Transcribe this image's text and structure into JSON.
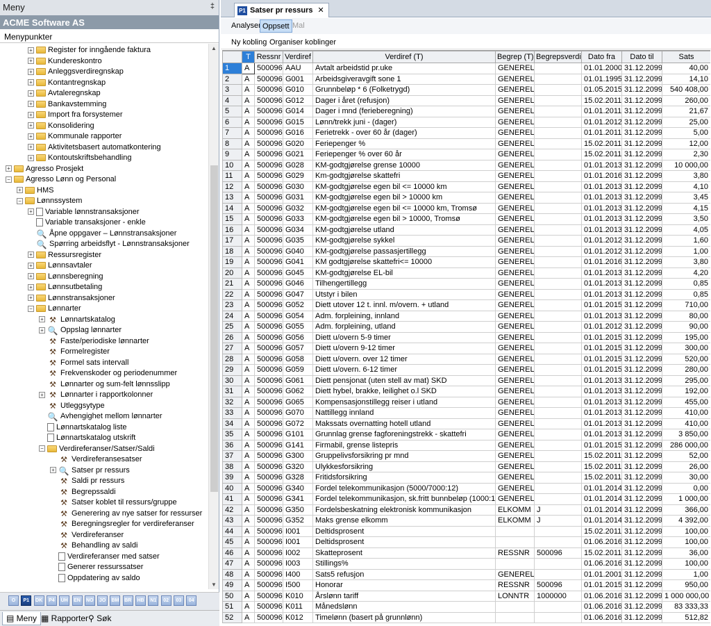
{
  "menu": {
    "title": "Meny",
    "pin": "‡",
    "company": "ACME Software AS",
    "section": "Menypunkter"
  },
  "tree": [
    {
      "l": "Register for inngående faktura",
      "lv": 2,
      "i": "folder",
      "e": "+"
    },
    {
      "l": "Kundereskontro",
      "lv": 2,
      "i": "folder",
      "e": "+"
    },
    {
      "l": "Anleggsverdiregnskap",
      "lv": 2,
      "i": "folder",
      "e": "+"
    },
    {
      "l": "Kontantregnskap",
      "lv": 2,
      "i": "folder",
      "e": "+"
    },
    {
      "l": "Avtaleregnskap",
      "lv": 2,
      "i": "folder",
      "e": "+"
    },
    {
      "l": "Bankavstemming",
      "lv": 2,
      "i": "folder",
      "e": "+"
    },
    {
      "l": "Import fra forsystemer",
      "lv": 2,
      "i": "folder",
      "e": "+"
    },
    {
      "l": "Konsolidering",
      "lv": 2,
      "i": "folder",
      "e": "+"
    },
    {
      "l": "Kommunale rapporter",
      "lv": 2,
      "i": "folder",
      "e": "+"
    },
    {
      "l": "Aktivitetsbasert automatkontering",
      "lv": 2,
      "i": "folder",
      "e": "+"
    },
    {
      "l": "Kontoutskriftsbehandling",
      "lv": 2,
      "i": "folder",
      "e": "+"
    },
    {
      "l": "Agresso Prosjekt",
      "lv": 0,
      "i": "folder",
      "e": "+"
    },
    {
      "l": "Agresso Lønn og Personal",
      "lv": 0,
      "i": "folder",
      "e": "−"
    },
    {
      "l": "HMS",
      "lv": 1,
      "i": "folder",
      "e": "+"
    },
    {
      "l": "Lønnssystem",
      "lv": 1,
      "i": "folder",
      "e": "−"
    },
    {
      "l": "Variable lønnstransaksjoner",
      "lv": 2,
      "i": "doc",
      "e": "+"
    },
    {
      "l": "Variable transaksjoner - enkle",
      "lv": 2,
      "i": "doc",
      "e": ""
    },
    {
      "l": "Åpne oppgaver – Lønnstransaksjoner",
      "lv": 2,
      "i": "mag",
      "e": ""
    },
    {
      "l": "Spørring arbeidsflyt - Lønnstransaksjoner",
      "lv": 2,
      "i": "mag",
      "e": ""
    },
    {
      "l": "Ressursregister",
      "lv": 2,
      "i": "folder",
      "e": "+"
    },
    {
      "l": "Lønnsavtaler",
      "lv": 2,
      "i": "folder",
      "e": "+"
    },
    {
      "l": "Lønnsberegning",
      "lv": 2,
      "i": "folder",
      "e": "+"
    },
    {
      "l": "Lønnsutbetaling",
      "lv": 2,
      "i": "folder",
      "e": "+"
    },
    {
      "l": "Lønnstransaksjoner",
      "lv": 2,
      "i": "folder",
      "e": "+"
    },
    {
      "l": "Lønnarter",
      "lv": 2,
      "i": "folder",
      "e": "−"
    },
    {
      "l": "Lønnartskatalog",
      "lv": 3,
      "i": "tool",
      "e": "+"
    },
    {
      "l": "Oppslag lønnarter",
      "lv": 3,
      "i": "mag",
      "e": "+"
    },
    {
      "l": "Faste/periodiske lønnarter",
      "lv": 3,
      "i": "tool",
      "e": ""
    },
    {
      "l": "Formelregister",
      "lv": 3,
      "i": "tool",
      "e": ""
    },
    {
      "l": "Formel sats intervall",
      "lv": 3,
      "i": "tool",
      "e": ""
    },
    {
      "l": "Frekvenskoder og periodenummer",
      "lv": 3,
      "i": "tool",
      "e": ""
    },
    {
      "l": "Lønnarter og sum-felt lønnsslipp",
      "lv": 3,
      "i": "tool",
      "e": ""
    },
    {
      "l": "Lønnarter i rapportkolonner",
      "lv": 3,
      "i": "tool",
      "e": "+"
    },
    {
      "l": "Utleggsytype",
      "lv": 3,
      "i": "tool",
      "e": ""
    },
    {
      "l": "Avhengighet mellom lønnarter",
      "lv": 3,
      "i": "mag",
      "e": ""
    },
    {
      "l": "Lønnartskatalog liste",
      "lv": 3,
      "i": "doc",
      "e": ""
    },
    {
      "l": "Lønnartskatalog utskrift",
      "lv": 3,
      "i": "doc",
      "e": ""
    },
    {
      "l": "Verdireferanser/Satser/Saldi",
      "lv": 3,
      "i": "folder",
      "e": "−"
    },
    {
      "l": "Verdireferansesatser",
      "lv": 4,
      "i": "tool",
      "e": ""
    },
    {
      "l": "Satser pr ressurs",
      "lv": 4,
      "i": "mag",
      "e": "+"
    },
    {
      "l": "Saldi pr ressurs",
      "lv": 4,
      "i": "tool",
      "e": ""
    },
    {
      "l": "Begrepssaldi",
      "lv": 4,
      "i": "tool",
      "e": ""
    },
    {
      "l": "Satser koblet til ressurs/gruppe",
      "lv": 4,
      "i": "tool",
      "e": ""
    },
    {
      "l": "Generering av nye satser for ressurser",
      "lv": 4,
      "i": "tool",
      "e": ""
    },
    {
      "l": "Beregningsregler for verdireferanser",
      "lv": 4,
      "i": "tool",
      "e": ""
    },
    {
      "l": "Verdireferanser",
      "lv": 4,
      "i": "tool",
      "e": ""
    },
    {
      "l": "Behandling av saldi",
      "lv": 4,
      "i": "tool",
      "e": ""
    },
    {
      "l": "Verdireferanser med satser",
      "lv": 4,
      "i": "doc",
      "e": ""
    },
    {
      "l": "Generer ressurssatser",
      "lv": 4,
      "i": "doc",
      "e": ""
    },
    {
      "l": "Oppdatering av saldo",
      "lv": 4,
      "i": "doc",
      "e": ""
    }
  ],
  "iconbar": [
    "O",
    "P1",
    "DK",
    "P4",
    "UH",
    "EN",
    "NO",
    "JO",
    "BM",
    "BR",
    "HB",
    "N1",
    "02",
    "03",
    "04"
  ],
  "bottom_tabs": {
    "meny": "Meny",
    "rapporter": "Rapporter",
    "sok": "Søk"
  },
  "doc_tab": {
    "icon": "P1",
    "title": "Satser pr ressurs",
    "close": "✕"
  },
  "toolbar": {
    "analyser": "Analyser",
    "oppsett": "Oppsett",
    "mal": "Mal",
    "ny_kobling": "Ny kobling",
    "organiser": "Organiser koblinger"
  },
  "columns": [
    "",
    "T",
    "Ressnr",
    "Verdiref",
    "Verdiref (T)",
    "Begrep (T)",
    "Begrepsverdi",
    "Dato fra",
    "Dato til",
    "Sats"
  ],
  "rows": [
    [
      "1",
      "A",
      "500096",
      "AAU",
      "Avtalt arbeidstid pr.uke",
      "GENERELL",
      "",
      "01.01.2000",
      "31.12.2099",
      "40,00"
    ],
    [
      "2",
      "A",
      "500096",
      "G001",
      "Arbeidsgiveravgift sone 1",
      "GENERELL",
      "",
      "01.01.1995",
      "31.12.2099",
      "14,10"
    ],
    [
      "3",
      "A",
      "500096",
      "G010",
      "Grunnbeløp * 6 (Folketrygd)",
      "GENERELL",
      "",
      "01.05.2015",
      "31.12.2099",
      "540 408,00"
    ],
    [
      "4",
      "A",
      "500096",
      "G012",
      "Dager i året (refusjon)",
      "GENERELL",
      "",
      "15.02.2011",
      "31.12.2099",
      "260,00"
    ],
    [
      "5",
      "A",
      "500096",
      "G014",
      "Dager i mnd (ferieberegning)",
      "GENERELL",
      "",
      "01.01.2011",
      "31.12.2099",
      "21,67"
    ],
    [
      "6",
      "A",
      "500096",
      "G015",
      "Lønn/trekk juni - (dager)",
      "GENERELL",
      "",
      "01.01.2012",
      "31.12.2099",
      "25,00"
    ],
    [
      "7",
      "A",
      "500096",
      "G016",
      "Ferietrekk - over 60 år (dager)",
      "GENERELL",
      "",
      "01.01.2011",
      "31.12.2099",
      "5,00"
    ],
    [
      "8",
      "A",
      "500096",
      "G020",
      "Feriepenger %",
      "GENERELL",
      "",
      "15.02.2011",
      "31.12.2099",
      "12,00"
    ],
    [
      "9",
      "A",
      "500096",
      "G021",
      "Feriepenger % over 60 år",
      "GENERELL",
      "",
      "15.02.2011",
      "31.12.2099",
      "2,30"
    ],
    [
      "10",
      "A",
      "500096",
      "G028",
      "KM-godtgjørelse grense 10000",
      "GENERELL",
      "",
      "01.01.2013",
      "31.12.2099",
      "10 000,00"
    ],
    [
      "11",
      "A",
      "500096",
      "G029",
      "Km-godtgjørelse skattefri",
      "GENERELL",
      "",
      "01.01.2016",
      "31.12.2099",
      "3,80"
    ],
    [
      "12",
      "A",
      "500096",
      "G030",
      "KM-godtgjørelse egen bil <= 10000 km",
      "GENERELL",
      "",
      "01.01.2013",
      "31.12.2099",
      "4,10"
    ],
    [
      "13",
      "A",
      "500096",
      "G031",
      "KM-godtgjørelse egen bil > 10000 km",
      "GENERELL",
      "",
      "01.01.2013",
      "31.12.2099",
      "3,45"
    ],
    [
      "14",
      "A",
      "500096",
      "G032",
      "KM-godtgjørelse egen bil <= 10000 km, Tromsø",
      "GENERELL",
      "",
      "01.01.2013",
      "31.12.2099",
      "4,15"
    ],
    [
      "15",
      "A",
      "500096",
      "G033",
      "KM-godtgjørelse egen bil > 10000, Tromsø",
      "GENERELL",
      "",
      "01.01.2013",
      "31.12.2099",
      "3,50"
    ],
    [
      "16",
      "A",
      "500096",
      "G034",
      "KM-godtgjørelse utland",
      "GENERELL",
      "",
      "01.01.2013",
      "31.12.2099",
      "4,05"
    ],
    [
      "17",
      "A",
      "500096",
      "G035",
      "KM-godtgjørelse sykkel",
      "GENERELL",
      "",
      "01.01.2012",
      "31.12.2099",
      "1,60"
    ],
    [
      "18",
      "A",
      "500096",
      "G040",
      "KM-godtgjørelse passasjertillegg",
      "GENERELL",
      "",
      "01.01.2012",
      "31.12.2099",
      "1,00"
    ],
    [
      "19",
      "A",
      "500096",
      "G041",
      "KM godtgjørelse skattefri<= 10000",
      "GENERELL",
      "",
      "01.01.2016",
      "31.12.2099",
      "3,80"
    ],
    [
      "20",
      "A",
      "500096",
      "G045",
      "KM-godtgjørelse EL-bil",
      "GENERELL",
      "",
      "01.01.2013",
      "31.12.2099",
      "4,20"
    ],
    [
      "21",
      "A",
      "500096",
      "G046",
      "Tilhengertillegg",
      "GENERELL",
      "",
      "01.01.2013",
      "31.12.2099",
      "0,85"
    ],
    [
      "22",
      "A",
      "500096",
      "G047",
      "Utstyr i bilen",
      "GENERELL",
      "",
      "01.01.2013",
      "31.12.2099",
      "0,85"
    ],
    [
      "23",
      "A",
      "500096",
      "G052",
      "Diett utover 12 t. innl. m/overn. + utland",
      "GENERELL",
      "",
      "01.01.2015",
      "31.12.2099",
      "710,00"
    ],
    [
      "24",
      "A",
      "500096",
      "G054",
      "Adm. forpleining, innland",
      "GENERELL",
      "",
      "01.01.2013",
      "31.12.2099",
      "80,00"
    ],
    [
      "25",
      "A",
      "500096",
      "G055",
      "Adm. forpleining, utland",
      "GENERELL",
      "",
      "01.01.2012",
      "31.12.2099",
      "90,00"
    ],
    [
      "26",
      "A",
      "500096",
      "G056",
      "Diett u/overn 5-9 timer",
      "GENERELL",
      "",
      "01.01.2015",
      "31.12.2099",
      "195,00"
    ],
    [
      "27",
      "A",
      "500096",
      "G057",
      "Diett u/overn 9-12 timer",
      "GENERELL",
      "",
      "01.01.2015",
      "31.12.2099",
      "300,00"
    ],
    [
      "28",
      "A",
      "500096",
      "G058",
      "Diett u/overn. over 12 timer",
      "GENERELL",
      "",
      "01.01.2015",
      "31.12.2099",
      "520,00"
    ],
    [
      "29",
      "A",
      "500096",
      "G059",
      "Diett u/overn. 6-12 timer",
      "GENERELL",
      "",
      "01.01.2015",
      "31.12.2099",
      "280,00"
    ],
    [
      "30",
      "A",
      "500096",
      "G061",
      "Diett pensjonat (uten stell av mat) SKD",
      "GENERELL",
      "",
      "01.01.2013",
      "31.12.2099",
      "295,00"
    ],
    [
      "31",
      "A",
      "500096",
      "G062",
      "Diett hybel, brakke, leilighet o.l SKD",
      "GENERELL",
      "",
      "01.01.2013",
      "31.12.2099",
      "192,00"
    ],
    [
      "32",
      "A",
      "500096",
      "G065",
      "Kompensasjonstillegg reiser i utland",
      "GENERELL",
      "",
      "01.01.2013",
      "31.12.2099",
      "455,00"
    ],
    [
      "33",
      "A",
      "500096",
      "G070",
      "Nattillegg innland",
      "GENERELL",
      "",
      "01.01.2013",
      "31.12.2099",
      "410,00"
    ],
    [
      "34",
      "A",
      "500096",
      "G072",
      "Makssats overnatting hotell utland",
      "GENERELL",
      "",
      "01.01.2013",
      "31.12.2099",
      "410,00"
    ],
    [
      "35",
      "A",
      "500096",
      "G101",
      "Grunnlag grense fagforeningstrekk - skattefri",
      "GENERELL",
      "",
      "01.01.2013",
      "31.12.2099",
      "3 850,00"
    ],
    [
      "36",
      "A",
      "500096",
      "G141",
      "Firmabil, grense listepris",
      "GENERELL",
      "",
      "01.01.2015",
      "31.12.2099",
      "286 000,00"
    ],
    [
      "37",
      "A",
      "500096",
      "G300",
      "Gruppelivsforsikring pr mnd",
      "GENERELL",
      "",
      "15.02.2011",
      "31.12.2099",
      "52,00"
    ],
    [
      "38",
      "A",
      "500096",
      "G320",
      "Ulykkesforsikring",
      "GENERELL",
      "",
      "15.02.2011",
      "31.12.2099",
      "26,00"
    ],
    [
      "39",
      "A",
      "500096",
      "G328",
      "Fritidsforsikring",
      "GENERELL",
      "",
      "15.02.2011",
      "31.12.2099",
      "30,00"
    ],
    [
      "40",
      "A",
      "500096",
      "G340",
      "Fordel telekommunikasjon (5000/7000:12)",
      "GENERELL",
      "",
      "01.01.2014",
      "31.12.2099",
      "0,00"
    ],
    [
      "41",
      "A",
      "500096",
      "G341",
      "Fordel telekommunikasjon, sk.fritt bunnbeløp (1000:12)",
      "GENERELL",
      "",
      "01.01.2014",
      "31.12.2099",
      "1 000,00"
    ],
    [
      "42",
      "A",
      "500096",
      "G350",
      "Fordelsbeskatning elektronisk kommunikasjon",
      "ELKOMM",
      "J",
      "01.01.2014",
      "31.12.2099",
      "366,00"
    ],
    [
      "43",
      "A",
      "500096",
      "G352",
      "Maks grense elkomm",
      "ELKOMM",
      "J",
      "01.01.2014",
      "31.12.2099",
      "4 392,00"
    ],
    [
      "44",
      "A",
      "500096",
      "I001",
      "Deltidsprosent",
      "",
      "",
      "15.02.2011",
      "31.12.2099",
      "100,00"
    ],
    [
      "45",
      "A",
      "500096",
      "I001",
      "Deltidsprosent",
      "",
      "",
      "01.06.2016",
      "31.12.2099",
      "100,00"
    ],
    [
      "46",
      "A",
      "500096",
      "I002",
      "Skatteprosent",
      "RESSNR",
      "500096",
      "15.02.2011",
      "31.12.2099",
      "36,00"
    ],
    [
      "47",
      "A",
      "500096",
      "I003",
      "Stillings%",
      "",
      "",
      "01.06.2016",
      "31.12.2099",
      "100,00"
    ],
    [
      "48",
      "A",
      "500096",
      "I400",
      "Sats5 refusjon",
      "GENERELL",
      "",
      "01.01.2001",
      "31.12.2099",
      "1,00"
    ],
    [
      "49",
      "A",
      "500096",
      "I500",
      "Honorar",
      "RESSNR",
      "500096",
      "01.01.2015",
      "31.12.2099",
      "950,00"
    ],
    [
      "50",
      "A",
      "500096",
      "K010",
      "Årslønn tariff",
      "LONNTR",
      "1000000",
      "01.06.2016",
      "31.12.2099",
      "1 000 000,00"
    ],
    [
      "51",
      "A",
      "500096",
      "K011",
      "Månedslønn",
      "",
      "",
      "01.06.2016",
      "31.12.2099",
      "83 333,33"
    ],
    [
      "52",
      "A",
      "500096",
      "K012",
      "Timelønn (basert på grunnlønn)",
      "",
      "",
      "01.06.2016",
      "31.12.2099",
      "512,82"
    ]
  ]
}
